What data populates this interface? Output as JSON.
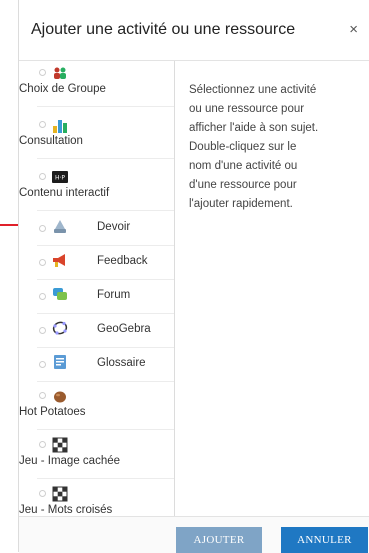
{
  "dialog": {
    "title": "Ajouter une activité ou une ressource",
    "close_label": "×"
  },
  "options": [
    {
      "label": "Choix de Groupe",
      "icon": "group-choice-icon",
      "layout": "stacked"
    },
    {
      "label": "Consultation",
      "icon": "bar-chart-icon",
      "layout": "stacked"
    },
    {
      "label": "Contenu interactif",
      "icon": "h5p-icon",
      "layout": "stacked"
    },
    {
      "label": "Devoir",
      "icon": "assignment-icon",
      "layout": "inline",
      "highlighted": true
    },
    {
      "label": "Feedback",
      "icon": "megaphone-icon",
      "layout": "inline"
    },
    {
      "label": "Forum",
      "icon": "forum-icon",
      "layout": "inline"
    },
    {
      "label": "GeoGebra",
      "icon": "geogebra-icon",
      "layout": "inline"
    },
    {
      "label": "Glossaire",
      "icon": "glossary-icon",
      "layout": "inline"
    },
    {
      "label": "Hot Potatoes",
      "icon": "hot-potatoes-icon",
      "layout": "stacked"
    },
    {
      "label": "Jeu - Image cachée",
      "icon": "game-image-icon",
      "layout": "stacked"
    },
    {
      "label": "Jeu - Mots croisés",
      "icon": "game-crossword-icon",
      "layout": "stacked"
    }
  ],
  "help": {
    "lines": [
      "Sélectionnez une activité",
      "ou une ressource pour",
      "afficher l'aide à son sujet.",
      "Double-cliquez sur le",
      "nom d'une activité ou",
      "d'une ressource pour",
      "l'ajouter rapidement."
    ]
  },
  "buttons": {
    "add_label": "AJOUTER",
    "cancel_label": "ANNULER"
  },
  "colors": {
    "annotation_arrow": "#e0202a",
    "add_button": "#7fa4c6",
    "cancel_button": "#1f78c3"
  }
}
